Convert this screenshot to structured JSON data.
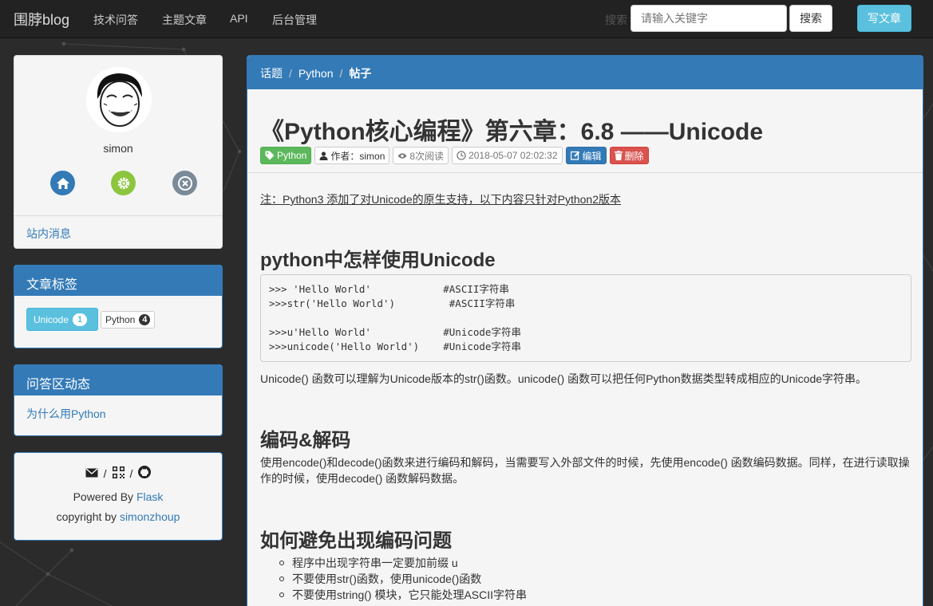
{
  "navbar": {
    "brand": "围脖blog",
    "items": [
      "技术问答",
      "主题文章",
      "API",
      "后台管理"
    ],
    "search_label": "搜索",
    "search_placeholder": "请输入关键字",
    "search_button": "搜索",
    "write_button": "写文章"
  },
  "profile": {
    "username": "simon",
    "icons": [
      "home-icon",
      "settings-icon",
      "logout-icon"
    ],
    "icon_colors": [
      "#337ab7",
      "#8cc63f",
      "#7a8a99"
    ],
    "messages_link": "站内消息"
  },
  "tags_panel": {
    "title": "文章标签",
    "tags": [
      {
        "label": "Unicode",
        "count": "1"
      },
      {
        "label": "Python",
        "count": "4"
      }
    ]
  },
  "qa_panel": {
    "title": "问答区动态",
    "items": [
      "为什么用Python"
    ]
  },
  "footer": {
    "icons": [
      "mail-icon",
      "qrcode-icon",
      "github-icon"
    ],
    "separator": "/",
    "powered_prefix": "Powered By ",
    "powered_link": "Flask",
    "copyright_prefix": "copyright by ",
    "copyright_link": "simonzhoup"
  },
  "breadcrumb": {
    "items": [
      "话题",
      "Python"
    ],
    "active": "帖子",
    "separator": "/"
  },
  "post": {
    "title": "《Python核心编程》第六章：6.8 ——Unicode",
    "meta": {
      "tag": "Python",
      "author": "作者：simon",
      "views": "8次阅读",
      "date": "2018-05-07 02:02:32",
      "edit": "编辑",
      "delete": "删除"
    },
    "note": "注：Python3 添加了对Unicode的原生支持，以下内容只针对Python2版本",
    "section1_title": "python中怎样使用Unicode",
    "code_lines": [
      ">>> 'Hello World'            #ASCII字符串",
      ">>>str('Hello World')         #ASCII字符串",
      "",
      ">>>u'Hello World'            #Unicode字符串",
      ">>>unicode('Hello World')    #Unicode字符串"
    ],
    "section1_para": "Unicode() 函数可以理解为Unicode版本的str()函数。unicode() 函数可以把任何Python数据类型转成相应的Unicode字符串。",
    "section2_title": "编码&解码",
    "section2_para": "使用encode()和decode()函数来进行编码和解码，当需要写入外部文件的时候，先使用encode() 函数编码数据。同样，在进行读取操作的时候，使用decode() 函数解码数据。",
    "section3_title": "如何避免出现编码问题",
    "section3_list": [
      "程序中出现字符串一定要加前缀 u",
      "不要使用str()函数，使用unicode()函数",
      "不要使用string() 模块，它只能处理ASCII字符串"
    ]
  }
}
